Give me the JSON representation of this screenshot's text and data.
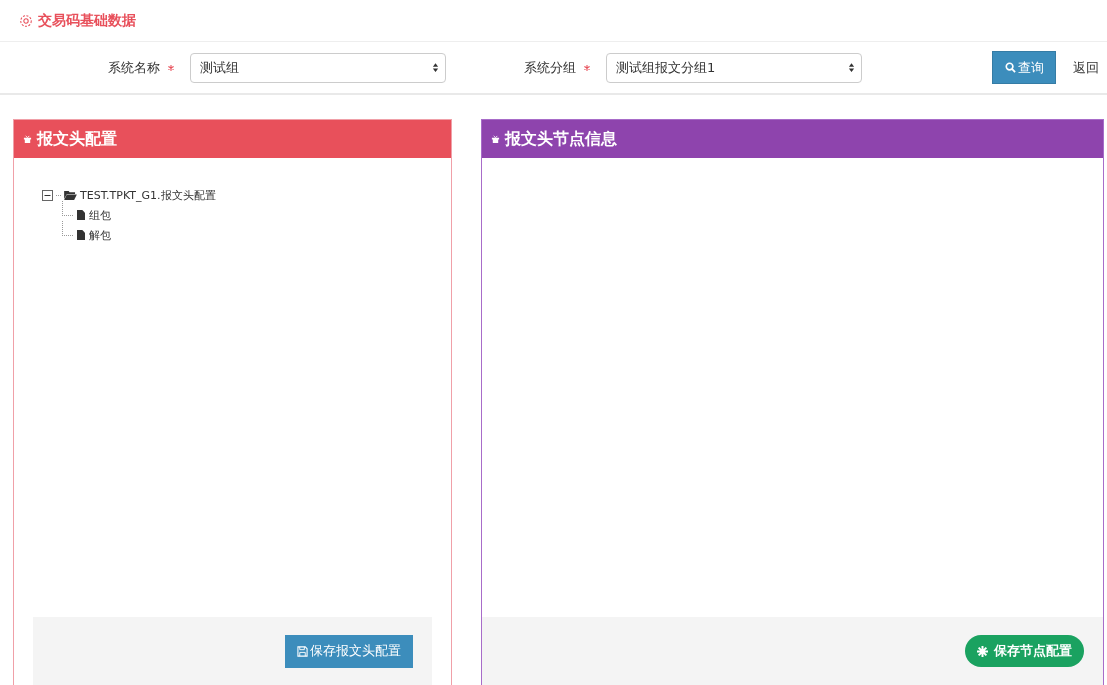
{
  "page_title": "交易码基础数据",
  "filters": [
    {
      "label": "系统名称",
      "required": true,
      "value": "测试组"
    },
    {
      "label": "系统分组",
      "required": true,
      "value": "测试组报文分组1"
    }
  ],
  "query_button": "查询",
  "back_link": "返回",
  "left_panel": {
    "title": "报文头配置",
    "tree": [
      {
        "label": "TEST.TPKT_G1.报文头配置",
        "expanded": true,
        "children": [
          {
            "label": "组包"
          },
          {
            "label": "解包"
          }
        ]
      }
    ],
    "save_button": "保存报文头配置"
  },
  "right_panel": {
    "title": "报文头节点信息",
    "save_button": "保存节点配置"
  }
}
